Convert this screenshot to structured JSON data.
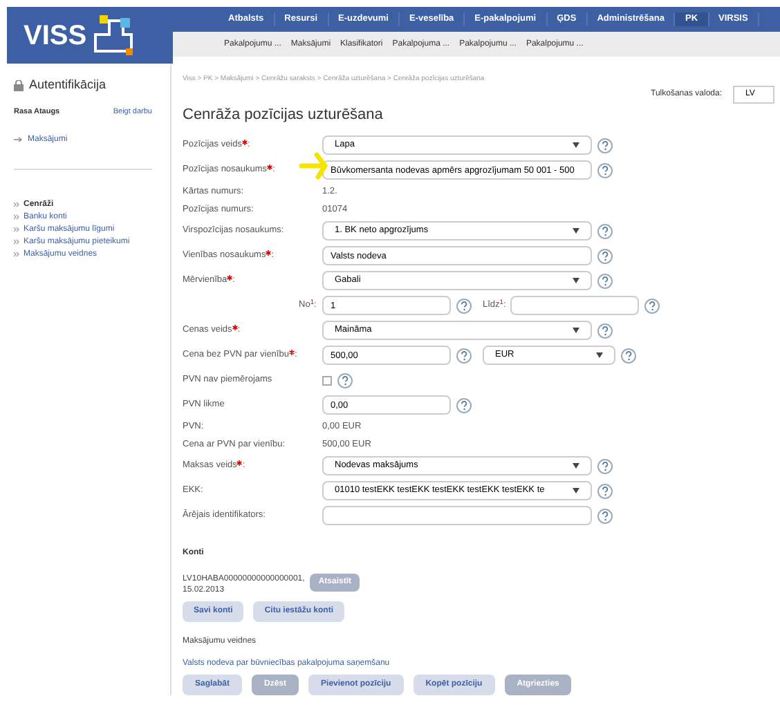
{
  "header": {
    "logo": "VISS",
    "nav": [
      {
        "label": "Atbalsts",
        "selected": false
      },
      {
        "label": "Resursi",
        "selected": false
      },
      {
        "label": "E-uzdevumi",
        "selected": false
      },
      {
        "label": "E-veselība",
        "selected": false
      },
      {
        "label": "E-pakalpojumi",
        "selected": false
      },
      {
        "label": "ĢDS",
        "selected": false
      },
      {
        "label": "Administrēšana",
        "selected": false
      },
      {
        "label": "PK",
        "selected": true
      },
      {
        "label": "VIRSIS",
        "selected": false
      }
    ],
    "subnav": [
      "Pakalpojumu ...",
      "Maksājumi",
      "Klasifikatori",
      "Pakalpojuma ...",
      "Pakalpojumu ...",
      "Pakalpojumu ..."
    ]
  },
  "sidebar": {
    "title": "Autentifikācija",
    "user": "Rasa Ataugs",
    "logout": "Beigt darbu",
    "back_link": "Maksājumi",
    "items": [
      {
        "label": "Cenrāži",
        "selected": true
      },
      {
        "label": "Banku konti",
        "selected": false
      },
      {
        "label": "Karšu maksājumu līgumi",
        "selected": false
      },
      {
        "label": "Karšu maksājumu pieteikumi",
        "selected": false
      },
      {
        "label": "Maksājumu veidnes",
        "selected": false
      }
    ]
  },
  "breadcrumb": "Viss > PK > Maksājumi > Cenrāžu saraksts > Cenrāža uzturēšana > Cenrāža pozīcijas uzturēšana",
  "language": {
    "label": "Tulkošanas valoda:",
    "value": "LV"
  },
  "title": "Cenrāža pozīcijas uzturēšana",
  "fields": [
    {
      "kind": "select",
      "label": "Pozīcijas veids",
      "required": true,
      "suffix": ":",
      "value": "Lapa"
    },
    {
      "kind": "input",
      "label": "Pozīcijas nosaukums",
      "required": true,
      "suffix": ":",
      "value": "Būvkomersanta nodevas apmērs apgrozījumam 50 001 - 500",
      "annotated": true
    },
    {
      "kind": "text",
      "label": "Kārtas numurs:",
      "value": "1.2."
    },
    {
      "kind": "text",
      "label": "Pozīcijas numurs:",
      "value": "01074"
    },
    {
      "kind": "select",
      "label": "Virspozīcijas nosaukums:",
      "value": "1. BK neto apgrozījums"
    },
    {
      "kind": "input",
      "label": "Vienības nosaukums",
      "required": true,
      "suffix": ":",
      "value": "Valsts nodeva"
    },
    {
      "kind": "select",
      "label": "Mērvienība",
      "required": true,
      "suffix": ":",
      "value": "Gabali"
    },
    {
      "kind": "range",
      "from_label": "No$^{1}$:",
      "from_value": "1",
      "to_label": "Līdz$^{1}$:"
    },
    {
      "kind": "select",
      "label": "Cenas veids",
      "required": true,
      "suffix": ":",
      "value": "Maināma"
    },
    {
      "kind": "price",
      "label": "Cena bez PVN par vienību",
      "required": true,
      "suffix": ":",
      "value": "500,00",
      "currency": "EUR"
    },
    {
      "kind": "checkbox",
      "label": "PVN nav piemērojams",
      "checked": false
    },
    {
      "kind": "short",
      "label": "PVN likme",
      "value": "0,00"
    },
    {
      "kind": "text",
      "label": "PVN:",
      "value": "0,00 EUR"
    },
    {
      "kind": "text",
      "label": "Cena ar PVN par vienību:",
      "value": "500,00 EUR"
    },
    {
      "kind": "select",
      "label": "Maksas veids",
      "required": true,
      "suffix": ":",
      "value": "Nodevas maksājums"
    },
    {
      "kind": "select",
      "label": "EKK:",
      "value": "01010 testEKK testEKK testEKK testEKK testEKK te"
    },
    {
      "kind": "input",
      "label": "Ārējais identifikators:"
    }
  ],
  "accounts": {
    "title": "Konti",
    "entry": "LV10HABA00000000000000001,\n15.02.2013",
    "unlink": "Atsaistīt",
    "buttons": [
      "Savi konti",
      "Citu iestāžu konti"
    ]
  },
  "templates": {
    "title": "Maksājumu veidnes",
    "link": "Valsts nodeva par būvniecības pakalpojuma saņemšanu"
  },
  "actions": [
    {
      "label": "Saglabāt",
      "disabled": false
    },
    {
      "label": "Dzēst",
      "disabled": true
    },
    {
      "label": "Pievienot pozīciju",
      "disabled": false
    },
    {
      "label": "Kopēt pozīciju",
      "disabled": false
    },
    {
      "label": "Atgriezties",
      "disabled": true
    }
  ]
}
